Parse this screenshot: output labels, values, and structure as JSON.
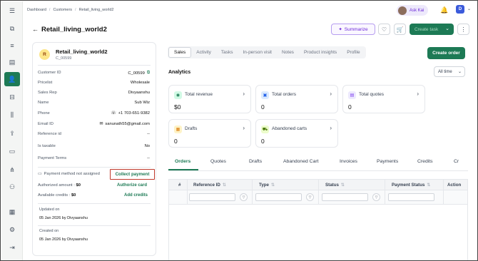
{
  "breadcrumbs": [
    "Dashboard",
    "Customers",
    "Retail_living_world2"
  ],
  "header": {
    "ask_kai": "Ask Kai",
    "user_initial": "D"
  },
  "page": {
    "title": "Retail_living_world2",
    "summarize": "Summarize",
    "create_task": "Create task"
  },
  "sidebar": {
    "icons": [
      "panel-icon",
      "copy-icon",
      "list-icon",
      "clipboard-icon",
      "user-icon",
      "box-icon",
      "sliders-icon",
      "upload-file-icon",
      "folder-icon",
      "network-icon",
      "user-gear-icon",
      "building-icon",
      "settings-icon",
      "logout-icon"
    ],
    "active_index": 4,
    "accent": "#1d7a55"
  },
  "customer": {
    "initial": "R",
    "name": "Retail_living_world2",
    "code": "C_00599",
    "fields": [
      {
        "key": "Customer ID",
        "value": "C_00599"
      },
      {
        "key": "Pricelist",
        "value": "Wholesale"
      },
      {
        "key": "Sales Rep",
        "value": "Divyaanshu"
      },
      {
        "key": "Name",
        "value": "Sub Wiz"
      },
      {
        "key": "Phone",
        "value": "+1 703-651-9382"
      },
      {
        "key": "Email ID",
        "value": "sanunath55@gmail.com"
      },
      {
        "key": "Reference id",
        "value": "--"
      },
      {
        "key": "Is taxable",
        "value": "No"
      },
      {
        "key": "Payment Terms",
        "value": "--"
      }
    ],
    "payment_method": "Payment method not assigned",
    "collect_payment": "Collect payment",
    "authorized_label": "Authorized amount :",
    "authorized_value": "$0",
    "authorize_card": "Authorize card",
    "credits_label": "Available credits :",
    "credits_value": "$0",
    "add_credits": "Add credits",
    "updated_label": "Updated on",
    "updated_value": "05 Jan 2026 by Divyaanshu",
    "created_label": "Created on",
    "created_value": "05 Jan 2026 by Divyaanshu"
  },
  "main": {
    "tabs": [
      "Sales",
      "Activity",
      "Tasks",
      "In-person visit",
      "Notes",
      "Product insights",
      "Profile"
    ],
    "active_tab": "Sales",
    "create_order": "Create order",
    "analytics": "Analytics",
    "range": "All time",
    "metrics": [
      {
        "label": "Total revenue",
        "value": "$0",
        "icon": "revenue-icon",
        "color": "#1d7a55"
      },
      {
        "label": "Total orders",
        "value": "0",
        "icon": "orders-icon",
        "color": "#2563eb"
      },
      {
        "label": "Total quotes",
        "value": "0",
        "icon": "quotes-icon",
        "color": "#7c3aed"
      },
      {
        "label": "Drafts",
        "value": "0",
        "icon": "drafts-icon",
        "color": "#d97706"
      },
      {
        "label": "Abandoned carts",
        "value": "0",
        "icon": "cart-icon",
        "color": "#4d7c0f"
      }
    ],
    "order_tabs": [
      "Orders",
      "Quotes",
      "Drafts",
      "Abandoned Cart",
      "Invoices",
      "Payments",
      "Credits",
      "Cr"
    ],
    "columns": [
      "#",
      "Reference ID",
      "Type",
      "Status",
      "Payment Status",
      "Action"
    ]
  }
}
